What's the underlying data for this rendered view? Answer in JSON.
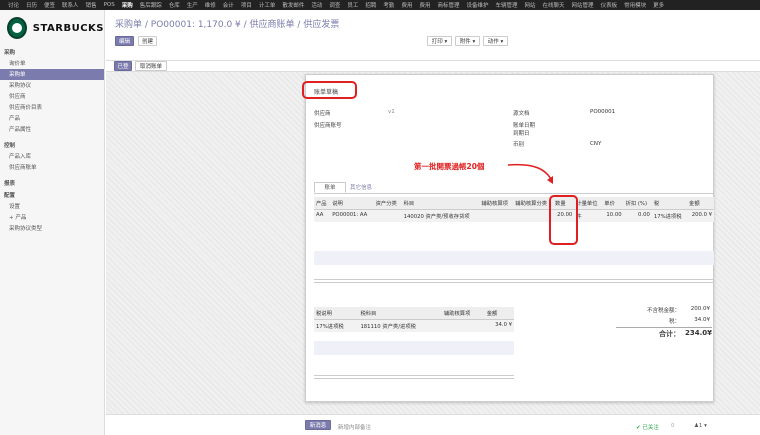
{
  "topnav": [
    "讨论",
    "日历",
    "便签",
    "联系人",
    "销售",
    "POS",
    "采购",
    "售后跟踪",
    "仓库",
    "生产",
    "维修",
    "会计",
    "项目",
    "计工单",
    "散发邮件",
    "活动",
    "调查",
    "员工",
    "招聘",
    "考勤",
    "费用",
    "费用",
    "商标管理",
    "设备维护",
    "车辆管理",
    "网站",
    "在线聊天",
    "网站管理",
    "仪表板",
    "常用模块",
    "更多"
  ],
  "active_top": "采购",
  "brand": "STARBUCKS",
  "sidebar": {
    "sec1": "采购",
    "items1": [
      "询价单",
      "采购单",
      "采购协议",
      "供应商",
      "供应商价目表",
      "产品",
      "产品属性"
    ],
    "sec2": "控制",
    "items2": [
      "产品入库",
      "供应商账单"
    ],
    "sec3": "报表",
    "sec4": "配置",
    "items4": [
      "设置",
      "+ 产品",
      "采购协议类型"
    ]
  },
  "breadcrumb": {
    "part1": "采购单 /",
    "part2": "PO00001: 1,170.0 ¥ /",
    "part3": "供应商账单 /",
    "part4": "供应发票"
  },
  "buttons": {
    "edit": "编辑",
    "create": "创建",
    "print": "打印 ▾",
    "attach": "附件 ▾",
    "action": "动作 ▾",
    "register": "已登",
    "cancel_bill": "取消账单"
  },
  "form": {
    "status": "账单草稿",
    "vendor_label": "供应商",
    "vendor_val": "v1",
    "vendor_ref_label": "供应商账号",
    "source_label": "源文档",
    "source_val": "PO00001",
    "bill_date_label": "账单日期",
    "due_date_label": "到期日",
    "currency_label": "币别",
    "currency_val": "CNY"
  },
  "tabs": {
    "bill": "账单",
    "other": "其它信息"
  },
  "annotation": "第一批開票過帳20個",
  "lines": {
    "headers": [
      "产品",
      "说明",
      "资产分类",
      "科目",
      "辅助核算项",
      "辅助核算分类",
      "数量",
      "计量单位",
      "单价",
      "折扣 (%)",
      "税",
      "金额"
    ],
    "row": [
      "AA",
      "PO00001: AA",
      "",
      "140020 资产类/预收存货项",
      "",
      "",
      "20.00",
      "件",
      "10.00",
      "0.00",
      "17%进项税",
      "200.0 ¥"
    ]
  },
  "taxes": {
    "headers": [
      "税说明",
      "税科目",
      "辅助核算项",
      "金额"
    ],
    "row": [
      "17%进项税",
      "181110 资产类/进项税",
      "",
      "34.0 ¥"
    ]
  },
  "totals": {
    "untaxed_label": "不含税金额：",
    "untaxed_val": "200.0¥",
    "tax_label": "税：",
    "tax_val": "34.0¥",
    "total_label": "合计：",
    "total_val": "234.0¥"
  },
  "chatter": {
    "new_msg": "新消息",
    "log_note": "新增内部备注",
    "follow": "✔ 已关注",
    "followers_count": "0",
    "sub": "♟1 ▾"
  },
  "colors": {
    "brand": "#7c7bad",
    "highlight": "#e02020"
  }
}
